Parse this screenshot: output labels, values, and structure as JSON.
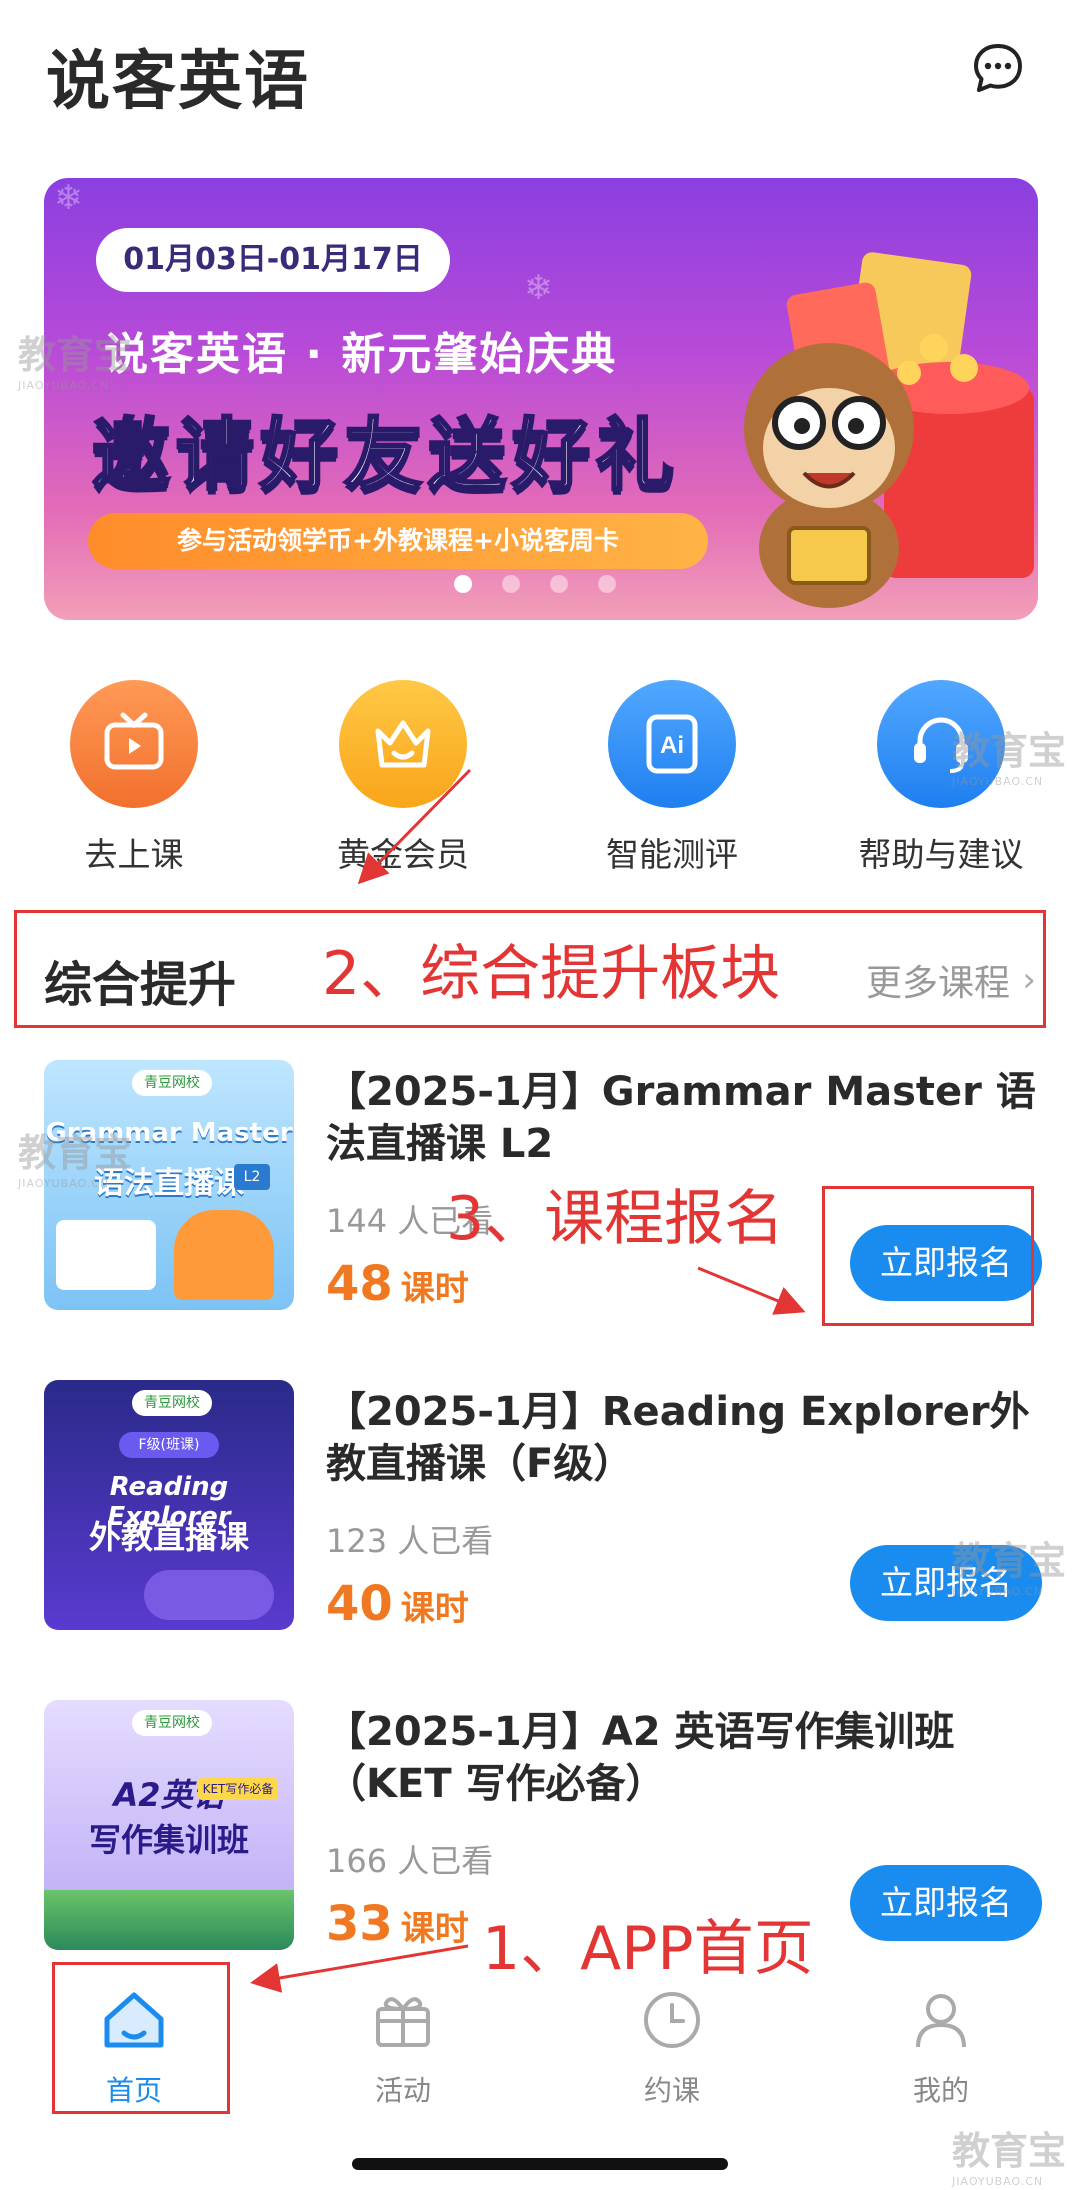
{
  "app": {
    "title": "说客英语"
  },
  "banner": {
    "date_range": "01月03日-01月17日",
    "subtitle": "说客英语 · 新元肇始庆典",
    "headline": "邀请好友送好礼",
    "pill": "参与活动领学币+外教课程+小说客周卡",
    "slide_count": 4,
    "active_slide": 1
  },
  "quick_entries": [
    {
      "label": "去上课",
      "icon": "tv-icon",
      "color": "#f5803a"
    },
    {
      "label": "黄金会员",
      "icon": "crown-icon",
      "color": "#fbb02a"
    },
    {
      "label": "智能测评",
      "icon": "ai-icon",
      "color": "#2f8cf0"
    },
    {
      "label": "帮助与建议",
      "icon": "headset-icon",
      "color": "#2f8cf0"
    }
  ],
  "section": {
    "title": "综合提升",
    "more": "更多课程"
  },
  "courses": [
    {
      "title": "【2025-1月】Grammar Master 语法直播课 L2",
      "views": "144 人已看",
      "hours": "48",
      "hours_unit": "课时",
      "button": "立即报名",
      "thumb_badge": "青豆网校",
      "thumb_title": "Grammar Master",
      "thumb_sub": "语法直播课",
      "thumb_level": "L2"
    },
    {
      "title": "【2025-1月】Reading Explorer外教直播课（F级）",
      "views": "123 人已看",
      "hours": "40",
      "hours_unit": "课时",
      "button": "立即报名",
      "thumb_badge": "青豆网校",
      "thumb_title": "Reading Explorer",
      "thumb_sub": "外教直播课",
      "thumb_level": "F级(班课)"
    },
    {
      "title": "【2025-1月】A2 英语写作集训班（KET 写作必备）",
      "views": "166 人已看",
      "hours": "33",
      "hours_unit": "课时",
      "button": "立即报名",
      "thumb_badge": "青豆网校",
      "thumb_title": "A2英语",
      "thumb_sub": "写作集训班",
      "thumb_level": "KET写作必备"
    }
  ],
  "tabs": [
    {
      "label": "首页",
      "icon": "home-icon",
      "active": true
    },
    {
      "label": "活动",
      "icon": "gift-icon",
      "active": false
    },
    {
      "label": "约课",
      "icon": "clock-icon",
      "active": false
    },
    {
      "label": "我的",
      "icon": "user-icon",
      "active": false
    }
  ],
  "annotations": {
    "a1": "1、APP首页",
    "a2": "2、综合提升板块",
    "a3": "3、课程报名"
  },
  "watermark": {
    "text": "教育宝",
    "sub": "JIAOYUBAO.CN"
  },
  "colors": {
    "accent": "#1a8cf0",
    "hours": "#f07820",
    "annotation": "#e43535"
  }
}
